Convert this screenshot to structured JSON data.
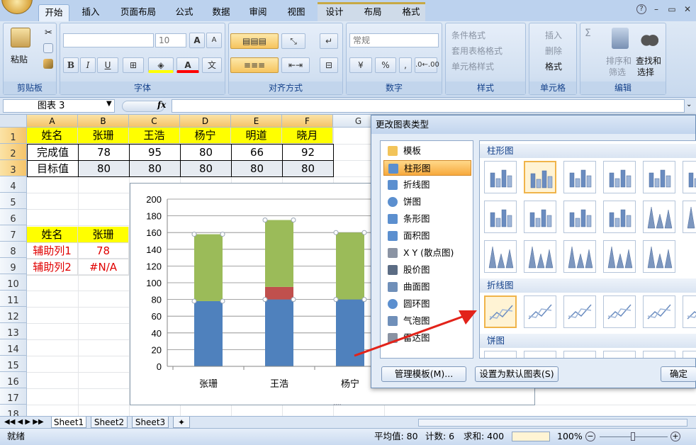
{
  "tabs": [
    {
      "label": "开始",
      "active": true
    },
    {
      "label": "插入"
    },
    {
      "label": "页面布局"
    },
    {
      "label": "公式"
    },
    {
      "label": "数据"
    },
    {
      "label": "审阅"
    },
    {
      "label": "视图"
    },
    {
      "label": "设计"
    },
    {
      "label": "布局"
    },
    {
      "label": "格式"
    }
  ],
  "window_controls": {
    "help": "?",
    "minimize": "–",
    "restore": "▭",
    "close": "✕"
  },
  "ribbon": {
    "clipboard": {
      "paste": "粘贴",
      "label": "剪贴板"
    },
    "font": {
      "size": "10",
      "bold": "B",
      "italic": "I",
      "underline": "U",
      "grow": "A",
      "shrink": "A",
      "label": "字体"
    },
    "alignment": {
      "label": "对齐方式"
    },
    "number": {
      "format": "常规",
      "label": "数字",
      "percent": "%",
      "comma": ","
    },
    "styles": {
      "conditional": "条件格式",
      "table": "套用表格格式",
      "cell": "单元格样式",
      "label": "样式"
    },
    "cells": {
      "insert": "插入",
      "delete": "删除",
      "format": "格式",
      "label": "单元格"
    },
    "editing": {
      "sum": "Σ",
      "sort_line1": "排序和",
      "sort_line2": "筛选",
      "find_line1": "查找和",
      "find_line2": "选择",
      "label": "编辑"
    }
  },
  "formula_bar": {
    "name_box": "图表 3",
    "fx": "fx",
    "value": ""
  },
  "columns": [
    {
      "label": "A",
      "selected": true
    },
    {
      "label": "B",
      "selected": true
    },
    {
      "label": "C",
      "selected": true
    },
    {
      "label": "D",
      "selected": true
    },
    {
      "label": "E",
      "selected": true
    },
    {
      "label": "F",
      "selected": true
    },
    {
      "label": "G",
      "selected": false
    }
  ],
  "rows": [
    "1",
    "2",
    "3",
    "4",
    "5",
    "6",
    "7",
    "8",
    "9",
    "10",
    "11",
    "12",
    "13",
    "14",
    "15",
    "16",
    "17",
    "18"
  ],
  "table1": {
    "header": [
      "姓名",
      "张珊",
      "王浩",
      "杨宁",
      "明道",
      "晓月"
    ],
    "row2": [
      "完成值",
      "78",
      "95",
      "80",
      "66",
      "92"
    ],
    "row3": [
      "目标值",
      "80",
      "80",
      "80",
      "80",
      "80"
    ]
  },
  "table2": {
    "header": [
      "姓名",
      "张珊"
    ],
    "row8": [
      "辅助列1",
      "78"
    ],
    "row9": [
      "辅助列2",
      "#N/A"
    ]
  },
  "chart_data": {
    "type": "bar",
    "stacked": true,
    "categories": [
      "张珊",
      "王浩",
      "杨宁"
    ],
    "series": [
      {
        "values": [
          78,
          80,
          80
        ],
        "color": "#4f81bd"
      },
      {
        "values": [
          0,
          15,
          0
        ],
        "color": "#c0504d"
      },
      {
        "values": [
          80,
          80,
          80
        ],
        "color": "#9bbb59"
      }
    ],
    "yticks": [
      "0",
      "20",
      "40",
      "60",
      "80",
      "100",
      "120",
      "140",
      "160",
      "180",
      "200"
    ],
    "ylim": [
      0,
      200
    ],
    "grid": true
  },
  "dialog": {
    "title": "更改图表类型",
    "types": [
      {
        "label": "模板",
        "icon": "folder-icon"
      },
      {
        "label": "柱形图",
        "icon": "column-chart-icon",
        "selected": true
      },
      {
        "label": "折线图",
        "icon": "line-chart-icon"
      },
      {
        "label": "饼图",
        "icon": "pie-chart-icon"
      },
      {
        "label": "条形图",
        "icon": "bar-chart-icon"
      },
      {
        "label": "面积图",
        "icon": "area-chart-icon"
      },
      {
        "label": "X Y (散点图)",
        "icon": "scatter-chart-icon"
      },
      {
        "label": "股价图",
        "icon": "stock-chart-icon"
      },
      {
        "label": "曲面图",
        "icon": "surface-chart-icon"
      },
      {
        "label": "圆环图",
        "icon": "doughnut-chart-icon"
      },
      {
        "label": "气泡图",
        "icon": "bubble-chart-icon"
      },
      {
        "label": "雷达图",
        "icon": "radar-chart-icon"
      }
    ],
    "sections": {
      "column": "柱形图",
      "line": "折线图",
      "pie": "饼图"
    },
    "buttons": {
      "manage": "管理模板(M)...",
      "set_default": "设置为默认图表(S)",
      "ok": "确定"
    }
  },
  "sheet_tabs": [
    "Sheet1",
    "Sheet2",
    "Sheet3"
  ],
  "status": {
    "ready": "就绪",
    "average": "平均值: 80",
    "count": "计数: 6",
    "sum": "求和: 400",
    "zoom": "100%"
  },
  "colors": {
    "accent": "#f6c45e",
    "highlight": "#ffff00",
    "red": "#e00000"
  }
}
